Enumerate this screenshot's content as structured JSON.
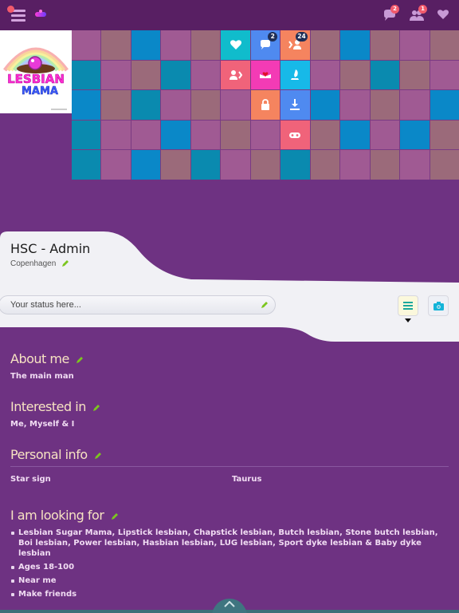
{
  "topbar": {
    "menu_icon": "hamburger-icon",
    "messages_badge": "2",
    "friends_badge": "1",
    "icons": [
      "hamburger-icon",
      "logo-mark-icon",
      "chat-bubble-icon",
      "users-icon",
      "heart-icon"
    ]
  },
  "logo": {
    "line1": "LESBIAN",
    "line2": "MAMA"
  },
  "grid": {
    "colors": {
      "P": "#a05a93",
      "B": "#9b6a7a",
      "C": "#0a88c8",
      "T": "#0a8aaf"
    },
    "rows": [
      [
        "P",
        "B",
        "C",
        "P",
        "B",
        "A0",
        "A1",
        "A2",
        "B",
        "C",
        "B",
        "P",
        "B"
      ],
      [
        "T",
        "P",
        "B",
        "T",
        "P",
        "A3",
        "A4",
        "A5",
        "P",
        "B",
        "T",
        "B",
        "P"
      ],
      [
        "C",
        "B",
        "T",
        "P",
        "B",
        "P",
        "A6",
        "A7",
        "C",
        "P",
        "B",
        "P",
        "C"
      ],
      [
        "T",
        "P",
        "P",
        "C",
        "P",
        "B",
        "P",
        "A8",
        "B",
        "C",
        "P",
        "C",
        "B"
      ],
      [
        "T",
        "P",
        "C",
        "B",
        "T",
        "P",
        "B",
        "T",
        "B",
        "P",
        "B",
        "P",
        "B"
      ]
    ],
    "actions": [
      {
        "id": "A0",
        "name": "favorites-tile",
        "icon": "heart-icon",
        "color": "#10bccc",
        "badge": ""
      },
      {
        "id": "A1",
        "name": "messages-tile",
        "icon": "chat-bubble-icon",
        "color": "#4f8af0",
        "badge": "2"
      },
      {
        "id": "A2",
        "name": "visitors-tile",
        "icon": "user-in-icon",
        "color": "#f5845f",
        "badge": "24"
      },
      {
        "id": "A3",
        "name": "visited-tile",
        "icon": "user-out-icon",
        "color": "#f0637a",
        "badge": ""
      },
      {
        "id": "A4",
        "name": "likes-tile",
        "icon": "heart-hands-icon",
        "color": "#f33bb5",
        "badge": ""
      },
      {
        "id": "A5",
        "name": "flirt-tile",
        "icon": "rocket-icon",
        "color": "#17b9e8",
        "badge": ""
      },
      {
        "id": "A6",
        "name": "privacy-tile",
        "icon": "lock-icon",
        "color": "#f5845f",
        "badge": ""
      },
      {
        "id": "A7",
        "name": "download-tile",
        "icon": "download-icon",
        "color": "#4f8af0",
        "badge": ""
      },
      {
        "id": "A8",
        "name": "games-tile",
        "icon": "gamepad-icon",
        "color": "#f0637a",
        "badge": ""
      }
    ]
  },
  "profile": {
    "name": "HSC - Admin",
    "city": "Copenhagen"
  },
  "status": {
    "placeholder": "Your status here..."
  },
  "sections": {
    "about": {
      "title": "About me",
      "text": "The main man"
    },
    "interested": {
      "title": "Interested in",
      "text": "Me, Myself & I"
    },
    "personal": {
      "title": "Personal info",
      "rows": [
        {
          "label": "Star sign",
          "value": "Taurus"
        }
      ]
    },
    "looking": {
      "title": "I am looking for",
      "items": [
        "Lesbian Sugar Mama, Lipstick lesbian, Chapstick lesbian, Butch lesbian, Stone butch lesbian, Boi lesbian, Power lesbian, Hasbian lesbian, LUG lesbian, Sport dyke lesbian & Baby dyke lesbian",
        "Ages 18-100",
        "Near me",
        "Make friends"
      ]
    }
  },
  "colors": {
    "topbar": "#581f63",
    "page_bg": "#6e3282",
    "accent_green": "#7cc61f",
    "title_text": "#f7e3c2"
  }
}
